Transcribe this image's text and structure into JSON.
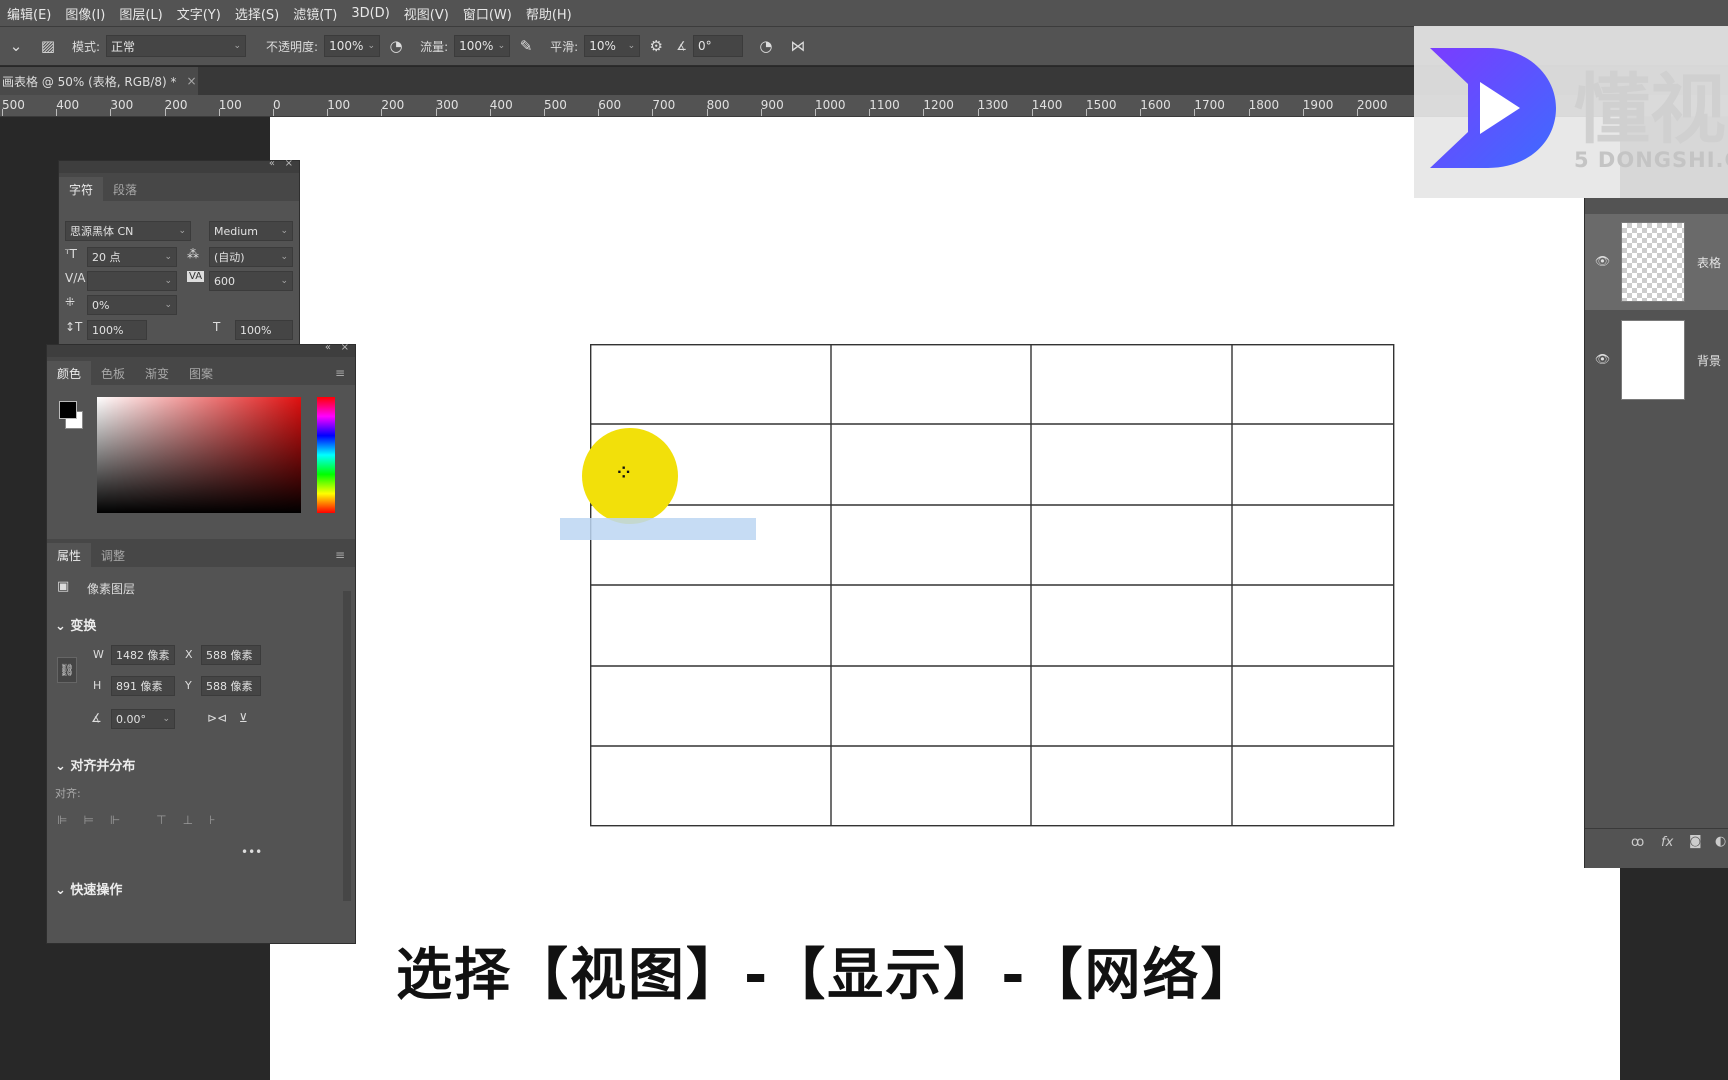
{
  "menu": [
    "编辑(E)",
    "图像(I)",
    "图层(L)",
    "文字(Y)",
    "选择(S)",
    "滤镜(T)",
    "3D(D)",
    "视图(V)",
    "窗口(W)",
    "帮助(H)"
  ],
  "options": {
    "mode_label": "模式:",
    "mode_value": "正常",
    "opacity_label": "不透明度:",
    "opacity_value": "100%",
    "flow_label": "流量:",
    "flow_value": "100%",
    "smooth_label": "平滑:",
    "smooth_value": "10%",
    "angle_value": "0°"
  },
  "document": {
    "tab_title": "画表格 @ 50% (表格, RGB/8) *",
    "close": "×"
  },
  "ruler": [
    "500",
    "400",
    "300",
    "200",
    "100",
    "0",
    "100",
    "200",
    "300",
    "400",
    "500",
    "600",
    "700",
    "800",
    "900",
    "1000",
    "1100",
    "1200",
    "1300",
    "1400",
    "1500",
    "1600",
    "1700",
    "1800",
    "1900",
    "2000"
  ],
  "character_panel": {
    "tabs": [
      "字符",
      "段落"
    ],
    "font_family": "思源黑体 CN",
    "font_style": "Medium",
    "font_size": "20 点",
    "leading": "(自动)",
    "kerning": "",
    "tracking": "600",
    "scale_percent": "0%",
    "vertical_scale": "100%",
    "horizontal_scale": "100%"
  },
  "color_panel": {
    "tabs": [
      "颜色",
      "色板",
      "渐变",
      "图案"
    ],
    "foreground": "#000000",
    "background": "#ffffff",
    "hue_color": "#e01010"
  },
  "properties_panel": {
    "tabs": [
      "属性",
      "调整"
    ],
    "layer_type": "像素图层",
    "transform_title": "变换",
    "w_label": "W",
    "w_value": "1482 像素",
    "h_label": "H",
    "h_value": "891 像素",
    "x_label": "X",
    "x_value": "588 像素",
    "y_label": "Y",
    "y_value": "588 像素",
    "angle_value": "0.00°",
    "align_title": "对齐并分布",
    "align_label": "对齐:",
    "more": "•••",
    "quick_title": "快速操作"
  },
  "layers": [
    {
      "name": "表格",
      "transparent": true
    },
    {
      "name": "背景",
      "transparent": false
    }
  ],
  "layer_footer": {
    "link": "ꝏ",
    "fx": "fx"
  },
  "logo": {
    "brand": "懂视",
    "url": "5 DONGSHI.C"
  },
  "subtitle": "选择【视图】-【显示】-【网络】",
  "colors": {
    "ui_bg": "#535353",
    "canvas": "#ffffff",
    "highlight": "#f2e00a",
    "logo_blue": "#3d6cff",
    "logo_purple": "#7a3cff"
  }
}
